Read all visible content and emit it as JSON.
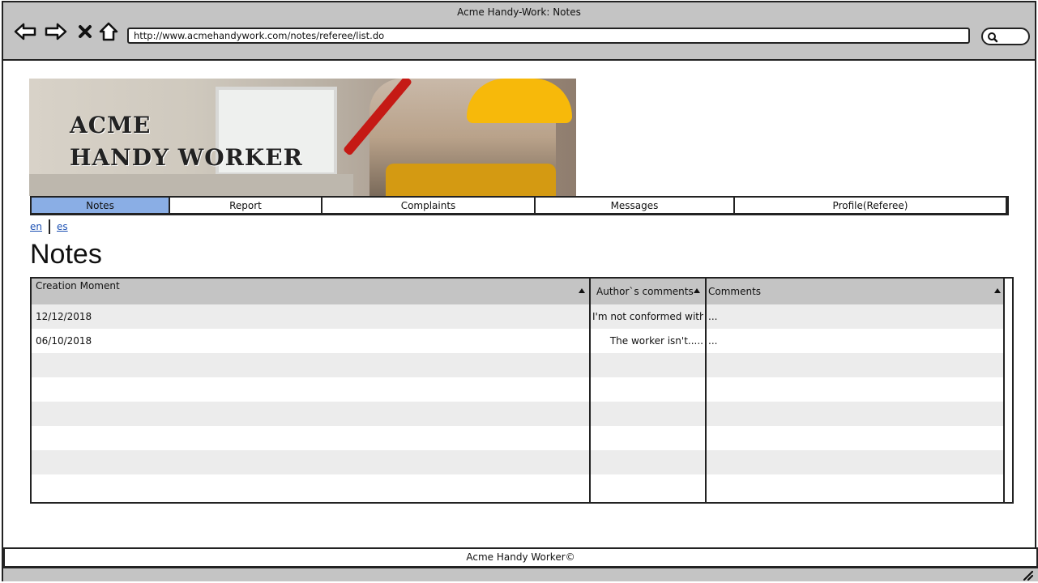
{
  "browser": {
    "title": "Acme Handy-Work: Notes",
    "url": "http://www.acmehandywork.com/notes/referee/list.do"
  },
  "banner": {
    "title_line1": "ACME",
    "title_line2": "HANDY WORKER"
  },
  "menu": {
    "items": [
      {
        "label": "Notes",
        "active": true
      },
      {
        "label": "Report",
        "active": false
      },
      {
        "label": "Complaints",
        "active": false
      },
      {
        "label": "Messages",
        "active": false
      },
      {
        "label": "Profile(Referee)",
        "active": false
      }
    ]
  },
  "lang": {
    "en": "en",
    "es": "es"
  },
  "page": {
    "title": "Notes"
  },
  "table": {
    "columns": [
      "Creation Moment",
      "Author`s comments",
      "Comments"
    ],
    "rows": [
      {
        "creation_moment": "12/12/2018",
        "authors_comments": "I'm not conformed with...",
        "comments": "..."
      },
      {
        "creation_moment": "06/10/2018",
        "authors_comments": "The worker isn't.....",
        "comments": "..."
      }
    ]
  },
  "footer": {
    "text": "Acme Handy Worker©"
  },
  "colors": {
    "chrome": "#c4c4c4",
    "menu_active": "#8aaee5",
    "row_alt": "#ececec",
    "link": "#1a4fb3"
  }
}
